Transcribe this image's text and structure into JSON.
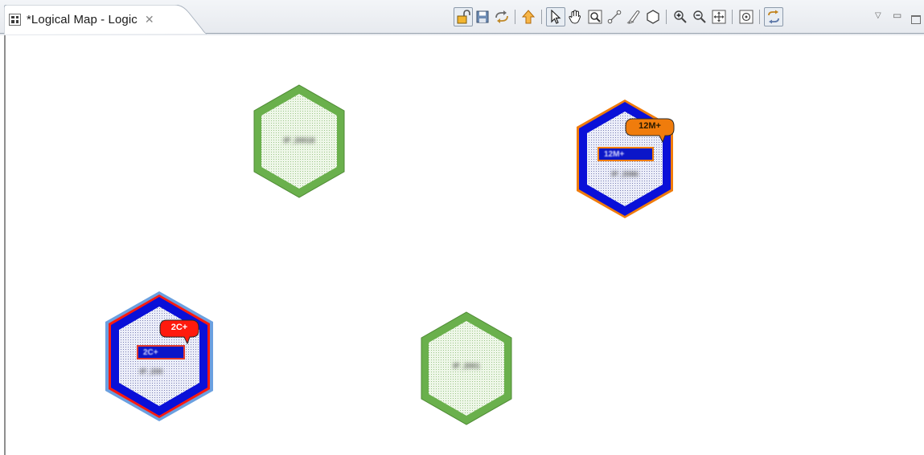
{
  "tab": {
    "title": "*Logical Map - Logic",
    "close_glyph": "✕",
    "icon": "logical-map-icon"
  },
  "toolbar": {
    "buttons": [
      {
        "name": "lock-icon",
        "pressed": true
      },
      {
        "name": "save-icon",
        "pressed": false
      },
      {
        "name": "refresh-icon",
        "pressed": false
      },
      {
        "name": "up-arrow-icon",
        "pressed": false
      },
      {
        "name": "select-pointer-icon",
        "pressed": true
      },
      {
        "name": "pan-hand-icon",
        "pressed": false
      },
      {
        "name": "zoom-region-icon",
        "pressed": false
      },
      {
        "name": "connect-link-icon",
        "pressed": false
      },
      {
        "name": "draw-pen-icon",
        "pressed": false
      },
      {
        "name": "hexagon-shape-icon",
        "pressed": false
      },
      {
        "name": "zoom-in-icon",
        "pressed": false
      },
      {
        "name": "zoom-out-icon",
        "pressed": false
      },
      {
        "name": "fit-to-window-icon",
        "pressed": false
      },
      {
        "name": "center-view-icon",
        "pressed": false
      },
      {
        "name": "sync-layout-icon",
        "pressed": true
      }
    ],
    "view_menu_glyph": "▽",
    "minimize_glyph": "▭"
  },
  "nodes": [
    {
      "id": "node-top-left",
      "label": "IP_20018",
      "style": "normal"
    },
    {
      "id": "node-top-right",
      "label": "IP_2086",
      "style": "major",
      "alarm_text": "12M+",
      "badge": "12M+"
    },
    {
      "id": "node-bottom-left",
      "label": "IP_200",
      "style": "critical",
      "alarm_text": "2C+",
      "badge": "2C+"
    },
    {
      "id": "node-bottom-center",
      "label": "IP_2001",
      "style": "normal"
    }
  ],
  "colors": {
    "normal_border": "#6ab04c",
    "normal_fill": "#e9f5e2",
    "alarm_ring": "#0a10d8",
    "alarm_fill": "#e4e6f8",
    "major": "#f07c0c",
    "critical": "#ff1a0d",
    "halo": "#5a8fd6"
  }
}
